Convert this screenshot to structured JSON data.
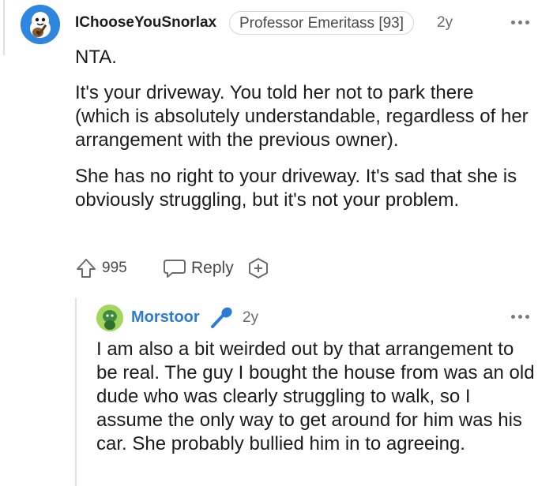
{
  "comment": {
    "username": "IChooseYouSnorlax",
    "flair": "Professor Emeritass [93]",
    "age": "2y",
    "paragraphs": [
      "NTA.",
      "It's your driveway. You told her not to park there (which is absolutely understandable, regardless of her arrangement with the previous owner).",
      "She has no right to your driveway. It's sad that she is obviously struggling, but it's not your problem."
    ],
    "score": "995",
    "reply_label": "Reply",
    "avatar_icon": "snoo-guitar-avatar",
    "upvote_icon": "upvote-arrow-icon",
    "reply_icon": "speech-bubble-icon",
    "award_icon": "award-plus-icon",
    "more_icon": "more-options-icon"
  },
  "reply": {
    "username": "Morstoor",
    "age": "2y",
    "text": "I am also a bit weirded out by that arrangement to be real. The guy I bought the house from was an old dude who was clearly struggling to walk, so I assume the only way to get around for him was his car. She probably bullied him in to agreeing.",
    "username_color": "#2c7bd6",
    "avatar_icon": "snoo-green-avatar",
    "badge_icon": "microphone-icon",
    "more_icon": "more-options-icon"
  },
  "colors": {
    "text": "#1c1c1c",
    "muted": "#6b6b6b",
    "link_blue": "#2c7bd6",
    "avatar_blue": "#2e86de",
    "avatar_green": "#a4d65e"
  }
}
